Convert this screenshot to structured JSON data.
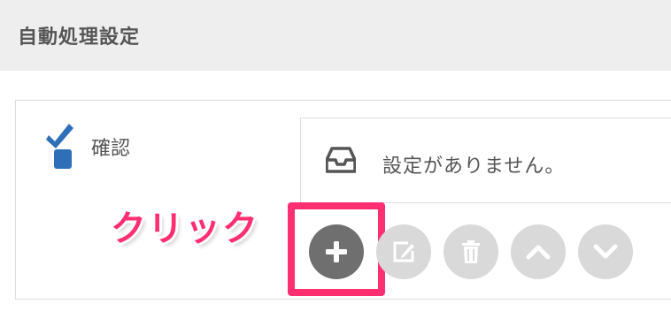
{
  "header": {
    "title": "自動処理設定"
  },
  "section": {
    "label": "確認",
    "icon": "checkbox-check-icon"
  },
  "empty_state": {
    "message": "設定がありません。",
    "icon": "inbox-icon"
  },
  "annotation": {
    "callout": "クリック",
    "highlight_color": "#ff2f72"
  },
  "toolbar": {
    "buttons": [
      {
        "name": "add",
        "icon": "plus-icon",
        "enabled": true,
        "color": "#6f6f6f"
      },
      {
        "name": "edit",
        "icon": "edit-icon",
        "enabled": false,
        "color": "#d9d9d9"
      },
      {
        "name": "delete",
        "icon": "trash-icon",
        "enabled": false,
        "color": "#d9d9d9"
      },
      {
        "name": "move-up",
        "icon": "chevron-up-icon",
        "enabled": false,
        "color": "#d9d9d9"
      },
      {
        "name": "move-down",
        "icon": "chevron-down-icon",
        "enabled": false,
        "color": "#d9d9d9"
      }
    ]
  },
  "colors": {
    "accent_blue": "#2e6fb8",
    "header_bg": "#eeeeee",
    "text": "#555555"
  }
}
